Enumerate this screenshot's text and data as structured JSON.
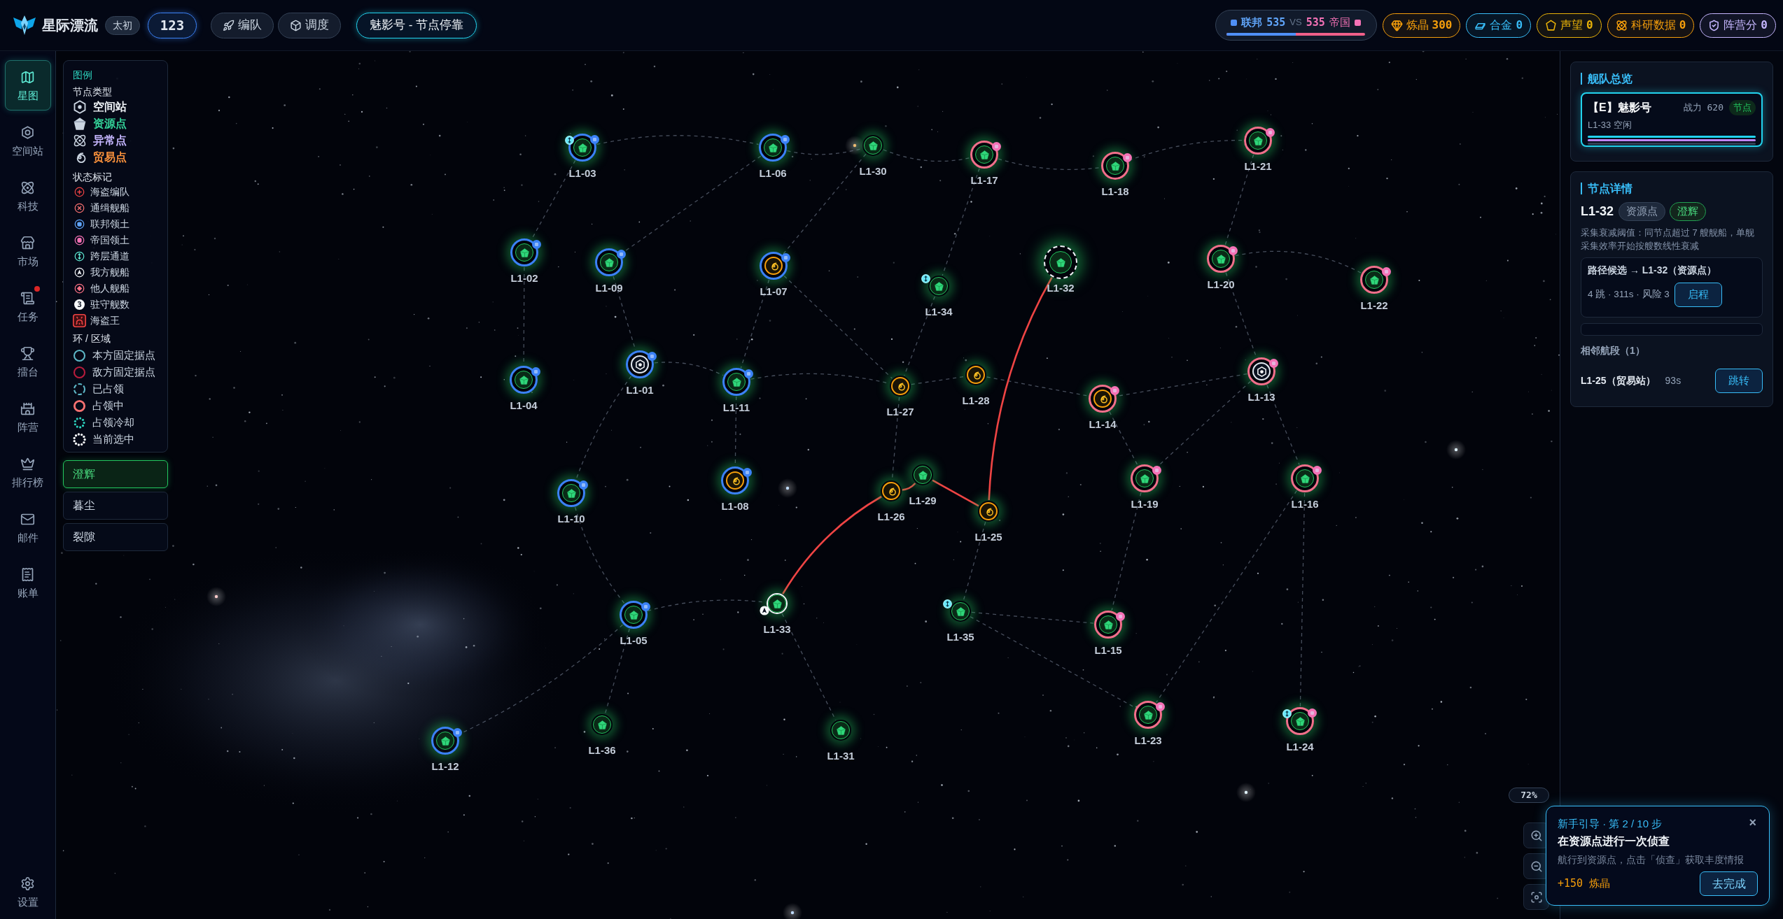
{
  "top_bar": {
    "title": "星际漂流",
    "edition": "太初",
    "player_id": "123",
    "nav_buttons": [
      {
        "label": "编队"
      },
      {
        "label": "调度"
      }
    ],
    "fleet_status": "魅影号 - 节点停靠",
    "faction_score": {
      "left_name": "联邦",
      "left_score": "535",
      "versus": "VS",
      "right_score": "535",
      "right_name": "帝国",
      "level": 0.5
    },
    "resources": [
      {
        "label": "炼晶",
        "value": "300",
        "color": "#f59e0b"
      },
      {
        "label": "合金",
        "value": "0",
        "color": "#38bdf8"
      },
      {
        "label": "声望",
        "value": "0",
        "color": "#eab308"
      },
      {
        "label": "科研数据",
        "value": "0",
        "color": "#f59e0b"
      },
      {
        "label": "阵营分",
        "value": "0",
        "color": "#c4b5fd"
      }
    ]
  },
  "sidebar": {
    "items": [
      {
        "label": "星图",
        "selected": true,
        "badge": false
      },
      {
        "label": "空间站",
        "selected": false,
        "badge": false
      },
      {
        "label": "科技",
        "selected": false,
        "badge": false
      },
      {
        "label": "市场",
        "selected": false,
        "badge": false
      },
      {
        "label": "任务",
        "selected": false,
        "badge": true
      },
      {
        "label": "擂台",
        "selected": false,
        "badge": false
      },
      {
        "label": "阵营",
        "selected": false,
        "badge": false
      },
      {
        "label": "排行榜",
        "selected": false,
        "badge": false
      },
      {
        "label": "邮件",
        "selected": false,
        "badge": false
      },
      {
        "label": "账单",
        "selected": false,
        "badge": false
      }
    ],
    "settings": "设置"
  },
  "legend": {
    "title": "图例",
    "sections": [
      {
        "kind": "node_types",
        "heading": "节点类型",
        "items": [
          {
            "label": "空间站",
            "color": "#f1f5f9"
          },
          {
            "label": "资源点",
            "color": "#34d399"
          },
          {
            "label": "异常点",
            "color": "#c4b5fd"
          },
          {
            "label": "贸易点",
            "color": "#fb923c"
          }
        ]
      },
      {
        "kind": "markers",
        "heading": "状态标记",
        "items": [
          {
            "label": "海盗编队",
            "kind": "icon",
            "color": "#ef4444"
          },
          {
            "label": "通缉舰船",
            "kind": "icon",
            "color": "#f87171"
          },
          {
            "label": "联邦领土",
            "kind": "icon",
            "color": "#60a5fa"
          },
          {
            "label": "帝国领土",
            "kind": "icon",
            "color": "#f472b6"
          },
          {
            "label": "跨层通道",
            "kind": "icon",
            "color": "#5eead4"
          },
          {
            "label": "我方舰船",
            "kind": "icon",
            "color": "#f8fafc"
          },
          {
            "label": "他人舰船",
            "kind": "icon",
            "color": "#fb7185"
          },
          {
            "label": "驻守舰数",
            "kind": "count",
            "glyph": "3",
            "color": "#f8fafc"
          },
          {
            "label": "海盗王",
            "kind": "icon",
            "color": "#ef4444"
          }
        ]
      },
      {
        "kind": "rings",
        "heading": "环 / 区域",
        "items": [
          {
            "label": "本方固定据点",
            "kind": "solid",
            "color": "#5eb8c8"
          },
          {
            "label": "敌方固定据点",
            "kind": "solid",
            "color": "#b91c3c"
          },
          {
            "label": "已占领",
            "kind": "dashed",
            "color": "#5eb8c8"
          },
          {
            "label": "占领中",
            "kind": "thick",
            "color": "#f87171"
          },
          {
            "label": "占领冷却",
            "kind": "dotted_small",
            "color": "#2dd4bf"
          },
          {
            "label": "当前选中",
            "kind": "dotted",
            "color": "#f8fafc"
          }
        ]
      }
    ]
  },
  "layers": [
    {
      "label": "澄辉",
      "selected": true
    },
    {
      "label": "暮尘",
      "selected": false
    },
    {
      "label": "裂隙",
      "selected": false
    }
  ],
  "map": {
    "zoom": "72%",
    "nodes": [
      {
        "label": "L1-03",
        "kind": "resource",
        "ring": {
          "kind": "thick",
          "color": "#3b82f6"
        },
        "territory": {
          "color": "#3b82f6"
        },
        "portal": true,
        "my_ship": false,
        "on_route": false,
        "selected": false
      },
      {
        "label": "L1-06",
        "kind": "resource",
        "ring": {
          "kind": "thick",
          "color": "#3b82f6"
        },
        "territory": {
          "color": "#3b82f6"
        },
        "portal": false,
        "my_ship": false,
        "on_route": false,
        "selected": false
      },
      {
        "label": "L1-30",
        "kind": "resource",
        "portal": false,
        "my_ship": false,
        "on_route": false,
        "selected": false
      },
      {
        "label": "L1-17",
        "kind": "resource",
        "ring": {
          "kind": "thick",
          "color": "#f0708a"
        },
        "territory": {
          "color": "#f472b6"
        },
        "portal": false,
        "my_ship": false,
        "on_route": false,
        "selected": false
      },
      {
        "label": "L1-18",
        "kind": "resource",
        "ring": {
          "kind": "thick",
          "color": "#f0708a"
        },
        "territory": {
          "color": "#f472b6"
        },
        "portal": false,
        "my_ship": false,
        "on_route": false,
        "selected": false
      },
      {
        "label": "L1-21",
        "kind": "resource",
        "ring": {
          "kind": "thick",
          "color": "#f0708a"
        },
        "territory": {
          "color": "#f472b6"
        },
        "portal": false,
        "my_ship": false,
        "on_route": false,
        "selected": false
      },
      {
        "label": "L1-02",
        "kind": "resource",
        "ring": {
          "kind": "thick",
          "color": "#3b82f6"
        },
        "territory": {
          "color": "#3b82f6"
        },
        "portal": false,
        "my_ship": false,
        "on_route": false,
        "selected": false
      },
      {
        "label": "L1-09",
        "kind": "resource",
        "ring": {
          "kind": "thick",
          "color": "#3b82f6"
        },
        "territory": {
          "color": "#3b82f6"
        },
        "portal": false,
        "my_ship": false,
        "on_route": false,
        "selected": false
      },
      {
        "label": "L1-07",
        "kind": "trade",
        "ring": {
          "kind": "thick",
          "color": "#3b82f6"
        },
        "territory": {
          "color": "#3b82f6"
        },
        "portal": false,
        "my_ship": false,
        "on_route": false,
        "selected": false
      },
      {
        "label": "L1-34",
        "kind": "resource",
        "portal": true,
        "my_ship": false,
        "on_route": false,
        "selected": false
      },
      {
        "label": "L1-32",
        "kind": "resource",
        "portal": false,
        "my_ship": false,
        "on_route": true,
        "selected": true
      },
      {
        "label": "L1-20",
        "kind": "resource",
        "ring": {
          "kind": "thick",
          "color": "#f0708a"
        },
        "territory": {
          "color": "#f472b6"
        },
        "portal": false,
        "my_ship": false,
        "on_route": false,
        "selected": false
      },
      {
        "label": "L1-22",
        "kind": "resource",
        "ring": {
          "kind": "thick",
          "color": "#f0708a"
        },
        "territory": {
          "color": "#f472b6"
        },
        "portal": false,
        "my_ship": false,
        "on_route": false,
        "selected": false
      },
      {
        "label": "L1-04",
        "kind": "resource",
        "ring": {
          "kind": "thick",
          "color": "#3b82f6"
        },
        "territory": {
          "color": "#3b82f6"
        },
        "portal": false,
        "my_ship": false,
        "on_route": false,
        "selected": false
      },
      {
        "label": "L1-01",
        "kind": "station",
        "ring": {
          "kind": "thick",
          "color": "#3b82f6"
        },
        "territory": {
          "color": "#3b82f6"
        },
        "portal": false,
        "my_ship": false,
        "on_route": false,
        "selected": false
      },
      {
        "label": "L1-11",
        "kind": "resource",
        "ring": {
          "kind": "thick",
          "color": "#3b82f6"
        },
        "territory": {
          "color": "#3b82f6"
        },
        "portal": false,
        "my_ship": false,
        "on_route": false,
        "selected": false
      },
      {
        "label": "L1-27",
        "kind": "trade",
        "portal": false,
        "my_ship": false,
        "on_route": false,
        "selected": false
      },
      {
        "label": "L1-28",
        "kind": "trade",
        "portal": false,
        "my_ship": false,
        "on_route": false,
        "selected": false
      },
      {
        "label": "L1-14",
        "kind": "trade",
        "ring": {
          "kind": "thick",
          "color": "#f0708a"
        },
        "territory": {
          "color": "#f472b6"
        },
        "portal": false,
        "my_ship": false,
        "on_route": false,
        "selected": false
      },
      {
        "label": "L1-13",
        "kind": "station",
        "ring": {
          "kind": "thick",
          "color": "#f0708a"
        },
        "territory": {
          "color": "#f472b6"
        },
        "portal": false,
        "my_ship": false,
        "on_route": false,
        "selected": false
      },
      {
        "label": "L1-10",
        "kind": "resource",
        "ring": {
          "kind": "thick",
          "color": "#3b82f6"
        },
        "territory": {
          "color": "#3b82f6"
        },
        "portal": false,
        "my_ship": false,
        "on_route": false,
        "selected": false
      },
      {
        "label": "L1-08",
        "kind": "trade",
        "ring": {
          "kind": "thick",
          "color": "#3b82f6"
        },
        "territory": {
          "color": "#3b82f6"
        },
        "portal": false,
        "my_ship": false,
        "on_route": false,
        "selected": false
      },
      {
        "label": "L1-26",
        "kind": "trade",
        "portal": false,
        "my_ship": false,
        "on_route": true,
        "selected": false
      },
      {
        "label": "L1-29",
        "kind": "resource",
        "portal": false,
        "my_ship": false,
        "on_route": true,
        "selected": false
      },
      {
        "label": "L1-25",
        "kind": "trade",
        "portal": false,
        "my_ship": false,
        "on_route": true,
        "selected": false
      },
      {
        "label": "L1-19",
        "kind": "resource",
        "ring": {
          "kind": "thick",
          "color": "#f0708a"
        },
        "territory": {
          "color": "#f472b6"
        },
        "portal": false,
        "my_ship": false,
        "on_route": false,
        "selected": false
      },
      {
        "label": "L1-16",
        "kind": "resource",
        "ring": {
          "kind": "thick",
          "color": "#f0708a"
        },
        "territory": {
          "color": "#f472b6"
        },
        "portal": false,
        "my_ship": false,
        "on_route": false,
        "selected": false
      },
      {
        "label": "L1-33",
        "kind": "resource",
        "ring": {
          "kind": "thin",
          "color": "#f1f5f9"
        },
        "portal": false,
        "my_ship": true,
        "on_route": true,
        "selected": false
      },
      {
        "label": "L1-05",
        "kind": "resource",
        "ring": {
          "kind": "thick",
          "color": "#3b82f6"
        },
        "territory": {
          "color": "#3b82f6"
        },
        "portal": false,
        "my_ship": false,
        "on_route": false,
        "selected": false
      },
      {
        "label": "L1-35",
        "kind": "resource",
        "portal": true,
        "my_ship": false,
        "on_route": false,
        "selected": false
      },
      {
        "label": "L1-15",
        "kind": "resource",
        "ring": {
          "kind": "thick",
          "color": "#f0708a"
        },
        "territory": {
          "color": "#f472b6"
        },
        "portal": false,
        "my_ship": false,
        "on_route": false,
        "selected": false
      },
      {
        "label": "L1-36",
        "kind": "resource",
        "portal": false,
        "my_ship": false,
        "on_route": false,
        "selected": false
      },
      {
        "label": "L1-31",
        "kind": "resource",
        "portal": false,
        "my_ship": false,
        "on_route": false,
        "selected": false
      },
      {
        "label": "L1-23",
        "kind": "resource",
        "ring": {
          "kind": "thick",
          "color": "#f0708a"
        },
        "territory": {
          "color": "#f472b6"
        },
        "portal": false,
        "my_ship": false,
        "on_route": false,
        "selected": false
      },
      {
        "label": "L1-24",
        "kind": "resource",
        "ring": {
          "kind": "thick",
          "color": "#f0708a"
        },
        "territory": {
          "color": "#f472b6"
        },
        "portal": true,
        "my_ship": false,
        "on_route": false,
        "selected": false
      },
      {
        "label": "L1-12",
        "kind": "resource",
        "ring": {
          "kind": "thick",
          "color": "#3b82f6"
        },
        "territory": {
          "color": "#3b82f6"
        },
        "portal": false,
        "my_ship": false,
        "on_route": false,
        "selected": false
      }
    ]
  },
  "fleet_overview": {
    "title": "舰队总览",
    "card": {
      "name": "【E】魅影号",
      "power": "战力 620",
      "status_tag": "节点",
      "location": "L1-33 空闲",
      "bars": [
        {
          "color": "#22d3ee"
        },
        {
          "color": "#c084fc"
        },
        {
          "color": "#334155"
        }
      ]
    }
  },
  "node_detail": {
    "title": "节点详情",
    "node_id": "L1-32",
    "tags": [
      {
        "label": "资源点",
        "kind": "type"
      },
      {
        "label": "澄辉",
        "kind": "layer"
      }
    ],
    "description": "采集衰减阈值：同节点超过 7 艘舰船，单舰采集效率开始按艘数线性衰减",
    "route": {
      "title": "路径候选 → L1-32（资源点）",
      "summary": "4 跳 · 311s · 风险 3",
      "button": "启程"
    },
    "adjacent_heading": "相邻航段（1）",
    "segments": [
      {
        "name": "L1-25（贸易站）",
        "time": "93s",
        "button": "跳转"
      }
    ]
  },
  "tutorial": {
    "step": "新手引导 · 第 2 / 10 步",
    "close": "×",
    "title": "在资源点进行一次侦查",
    "body": "航行到资源点，点击「侦查」获取丰度情报",
    "reward": "+150 炼晶",
    "button": "去完成"
  }
}
